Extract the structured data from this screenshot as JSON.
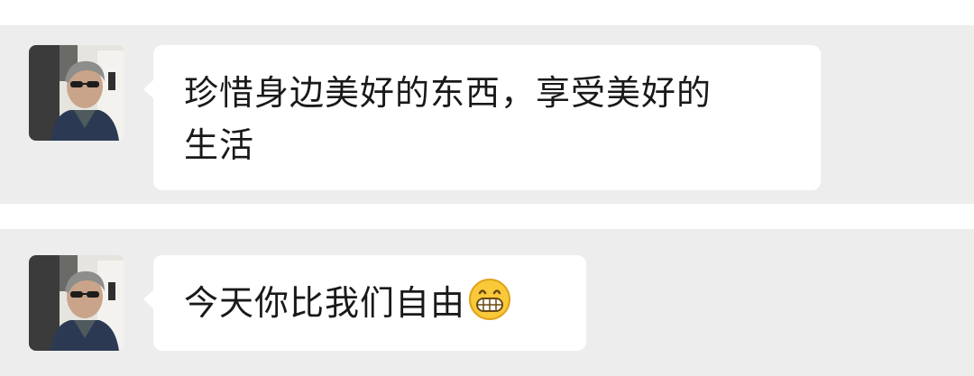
{
  "messages": [
    {
      "lines": [
        "珍惜身边美好的东西，享受美好的",
        "生活"
      ]
    },
    {
      "text": "今天你比我们自由",
      "emoji": "grinning-face-emoji"
    }
  ],
  "colors": {
    "chat_background": "#ededed",
    "bubble_background": "#ffffff",
    "text": "#191919"
  }
}
